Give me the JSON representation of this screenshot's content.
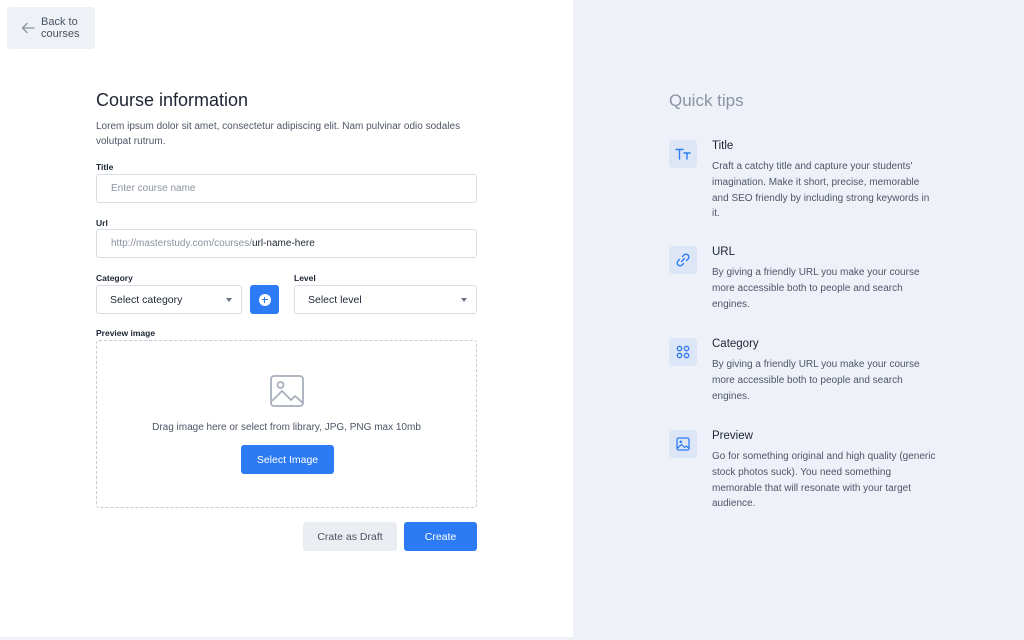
{
  "nav": {
    "back_label": "Back to courses"
  },
  "form": {
    "title": "Course information",
    "description": "Lorem ipsum dolor sit amet, consectetur adipiscing elit. Nam pulvinar odio sodales volutpat rutrum.",
    "title_label": "Title",
    "title_placeholder": "Enter course name",
    "url_label": "Url",
    "url_prefix": "http://masterstudy.com/courses/",
    "url_value": "url-name-here",
    "category_label": "Category",
    "category_value": "Select category",
    "level_label": "Level",
    "level_value": "Select level",
    "preview_label": "Preview image",
    "drop_text": "Drag image here or select from library, JPG, PNG max 10mb",
    "select_image_label": "Select Image",
    "draft_label": "Crate as Draft",
    "create_label": "Create"
  },
  "tips": {
    "heading": "Quick tips",
    "items": [
      {
        "icon": "text-size-icon",
        "title": "Title",
        "text": "Craft a catchy title and capture your students' imagination. Make it short, precise, memorable and SEO friendly by including strong keywords in it."
      },
      {
        "icon": "link-icon",
        "title": "URL",
        "text": "By giving a friendly URL you make your course more accessible both to people and search engines."
      },
      {
        "icon": "category-grid-icon",
        "title": "Category",
        "text": "By giving a friendly URL you make your course more accessible both to people and search engines."
      },
      {
        "icon": "image-icon",
        "title": "Preview",
        "text": "Go for something original and high quality (generic stock photos suck). You need something memorable that will resonate with your target audience."
      }
    ]
  },
  "colors": {
    "accent": "#2d7bf4",
    "tips_background": "#eef1f8",
    "icon_background": "#dde6f7"
  }
}
